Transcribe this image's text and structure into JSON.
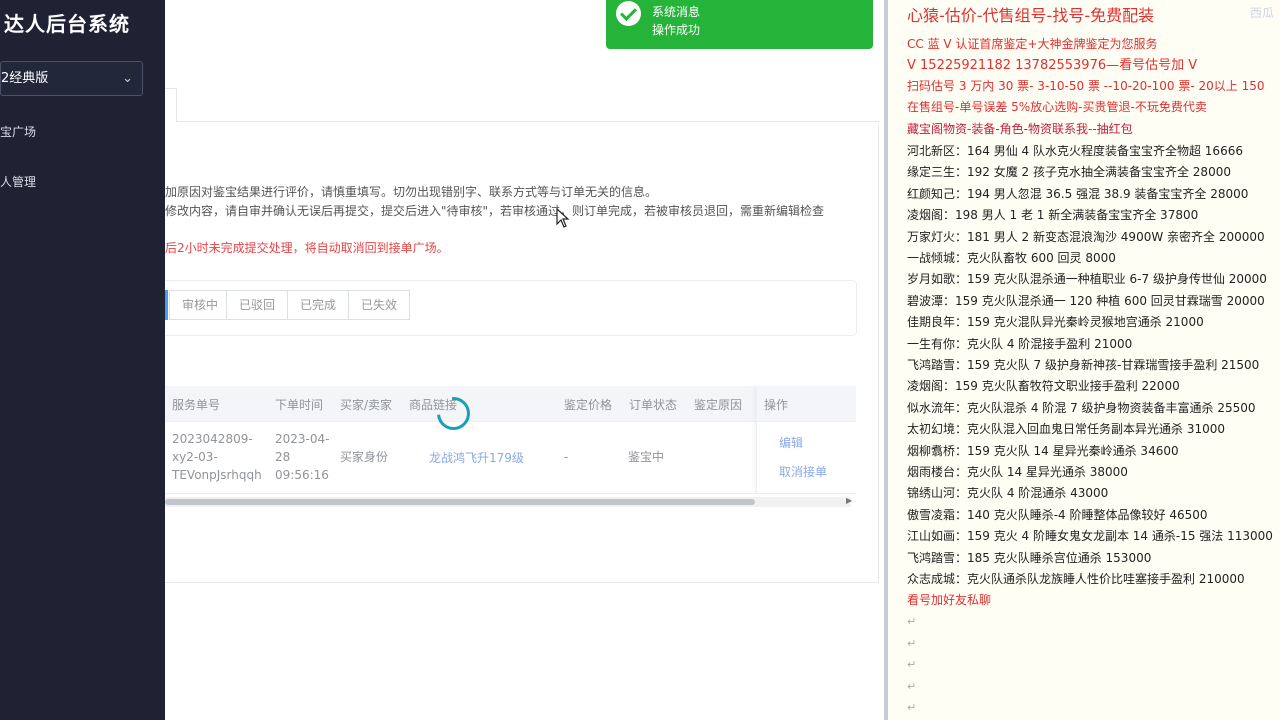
{
  "sidebar": {
    "brand": "达人后台系统",
    "version_select": "2经典版",
    "menu": [
      "宝广场",
      "人管理"
    ]
  },
  "notices": {
    "line1": "加原因对鉴宝结果进行评价，请慎重填写。切勿出现错别字、联系方式等与订单无关的信息。",
    "line2": "修改内容，请自审并确认无误后再提交，提交后进入\"待审核\"，若审核通过，则订单完成，若被审核员退回，需重新编辑检查",
    "line3": "后2小时未完成提交处理，将自动取消回到接单广场。"
  },
  "status_tabs": [
    "审核中",
    "已驳回",
    "已完成",
    "已失效"
  ],
  "table": {
    "headers": [
      "服务单号",
      "下单时间",
      "买家/卖家",
      "商品链接",
      "鉴定价格",
      "订单状态",
      "鉴定原因",
      "操作"
    ],
    "row": {
      "order_no": [
        "2023042809-",
        "xy2-03-",
        "TEVonpJsrhqqh"
      ],
      "time": [
        "2023-04-",
        "28",
        "09:56:16"
      ],
      "role": "买家身份",
      "product": "龙战鸿飞升179级",
      "price": "-",
      "status": "鉴宝中",
      "actions": [
        "编辑",
        "取消接单"
      ]
    }
  },
  "toast": {
    "title": "系统消息",
    "message": "操作成功"
  },
  "notes": {
    "corner_mark": "西瓜",
    "lines": [
      {
        "text": "心猿-估价-代售组号-找号-免费配装",
        "style": "h1"
      },
      {
        "text": "CC 蓝 V 认证首席鉴定+大神金牌鉴定为您服务",
        "style": "red"
      },
      {
        "text": "V 15225921182      13782553976—看号估号加 V",
        "style": "h2"
      },
      {
        "text": "扫码估号 3 万内 30 票- 3-10-50 票  --10-20-100 票- 20以上 150",
        "style": "red"
      },
      {
        "text": "在售组号-单号误差 5%放心选购-买贵管退-不玩免费代卖",
        "style": "red"
      },
      {
        "text": "藏宝阁物资-装备-角色-物资联系我--抽红包",
        "style": "crimson"
      },
      {
        "text": "河北新区：164 男仙 4 队水克火程度装备宝宝齐全物超 16666",
        "style": ""
      },
      {
        "text": "缘定三生：192 女魔 2 孩子克水抽全满装备宝宝齐全 28000",
        "style": ""
      },
      {
        "text": "红颜知己：194 男人忽混 36.5 强混 38.9 装备宝宝齐全 28000",
        "style": ""
      },
      {
        "text": "凌烟阁：198 男人 1 老 1 新全满装备宝宝齐全 37800",
        "style": ""
      },
      {
        "text": "万家灯火：181 男人 2 新变态混浪淘沙 4900W 亲密齐全 200000",
        "style": ""
      },
      {
        "text": "一战倾城：克火队畜牧 600 回灵 8000",
        "style": ""
      },
      {
        "text": "岁月如歌：159 克火队混杀通一种植职业 6-7 级护身传世仙 20000",
        "style": ""
      },
      {
        "text": "碧波潭：159 克火队混杀通一 120 种植 600 回灵甘霖瑞雪 20000",
        "style": ""
      },
      {
        "text": "佳期良年：159 克火混队异光秦岭灵猴地宫通杀 21000",
        "style": ""
      },
      {
        "text": "一生有你：克火队 4 阶混接手盈利 21000",
        "style": ""
      },
      {
        "text": "飞鸿踏雪：159 克火队 7 级护身新神孩-甘霖瑞雪接手盈利 21500",
        "style": ""
      },
      {
        "text": "凌烟阁：159 克火队畜牧符文职业接手盈利 22000",
        "style": ""
      },
      {
        "text": "似水流年：克火队混杀 4 阶混 7 级护身物资装备丰富通杀 25500",
        "style": ""
      },
      {
        "text": "太初幻境：克火队混入回血鬼日常任务副本异光通杀 31000",
        "style": ""
      },
      {
        "text": "烟柳翥桥：159 克火队 14 星异光秦岭通杀 34600",
        "style": ""
      },
      {
        "text": "烟雨楼台：克火队 14 星异光通杀 38000",
        "style": ""
      },
      {
        "text": "锦绣山河：克火队 4 阶混通杀 43000",
        "style": ""
      },
      {
        "text": "傲雪凌霜：140 克火队睡杀-4 阶睡整体品像较好 46500",
        "style": ""
      },
      {
        "text": "江山如画：159 克火 4 阶睡女鬼女龙副本 14 通杀-15 强法 113000",
        "style": ""
      },
      {
        "text": "飞鸿踏雪：185 克火队睡杀宫位通杀 153000",
        "style": ""
      },
      {
        "text": "众志成城：克火队通杀队龙族睡人性价比哇塞接手盈利 210000",
        "style": ""
      },
      {
        "text": "看号加好友私聊",
        "style": "red"
      }
    ],
    "empty_marks": [
      "↵",
      "↵",
      "↵",
      "↵",
      "↵"
    ]
  }
}
